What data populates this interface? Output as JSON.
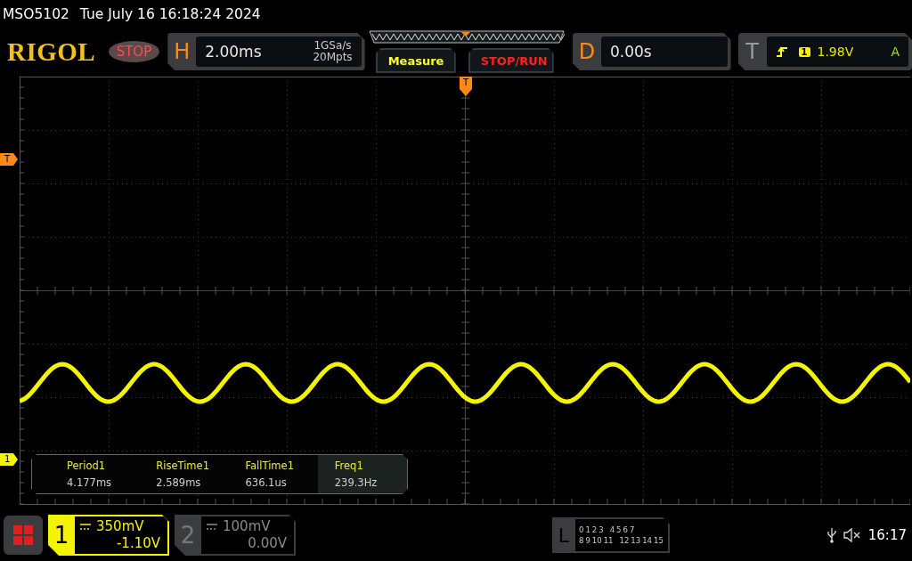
{
  "header": {
    "model": "MSO5102",
    "datetime": "Tue July 16 16:18:24 2024"
  },
  "toolbar": {
    "logo": "RIGOL",
    "run_state": "STOP",
    "horizontal": {
      "label": "H",
      "scale": "2.00ms",
      "sample_rate": "1GSa/s",
      "memory_depth": "20Mpts"
    },
    "buttons": [
      {
        "label": "Measure",
        "kind": "measure"
      },
      {
        "label": "STOP/RUN",
        "kind": "run"
      }
    ],
    "delay": {
      "label": "D",
      "value": "0.00s"
    },
    "trigger": {
      "label": "T",
      "source": "1",
      "level": "1.98V",
      "mode": "A"
    }
  },
  "markers": {
    "trigger_position": "T",
    "trigger_level": "T",
    "channel": "1"
  },
  "measurements": [
    {
      "name": "Period1",
      "value": "4.177ms",
      "selected": false
    },
    {
      "name": "RiseTime1",
      "value": "2.589ms",
      "selected": false
    },
    {
      "name": "FallTime1",
      "value": "636.1us",
      "selected": false
    },
    {
      "name": "Freq1",
      "value": "239.3Hz",
      "selected": true
    }
  ],
  "channels": [
    {
      "label": "1",
      "scale": "350mV",
      "offset": "-1.10V",
      "on": true
    },
    {
      "label": "2",
      "scale": "100mV",
      "offset": "0.00V",
      "on": false
    }
  ],
  "logic": {
    "label": "L",
    "row_1": [
      "0",
      "1",
      "2",
      "3",
      "4",
      "5",
      "6",
      "7"
    ],
    "row_2": [
      "8",
      "9",
      "10",
      "11",
      "12",
      "13",
      "14",
      "15"
    ]
  },
  "status": {
    "muted": true,
    "time": "16:17"
  }
}
